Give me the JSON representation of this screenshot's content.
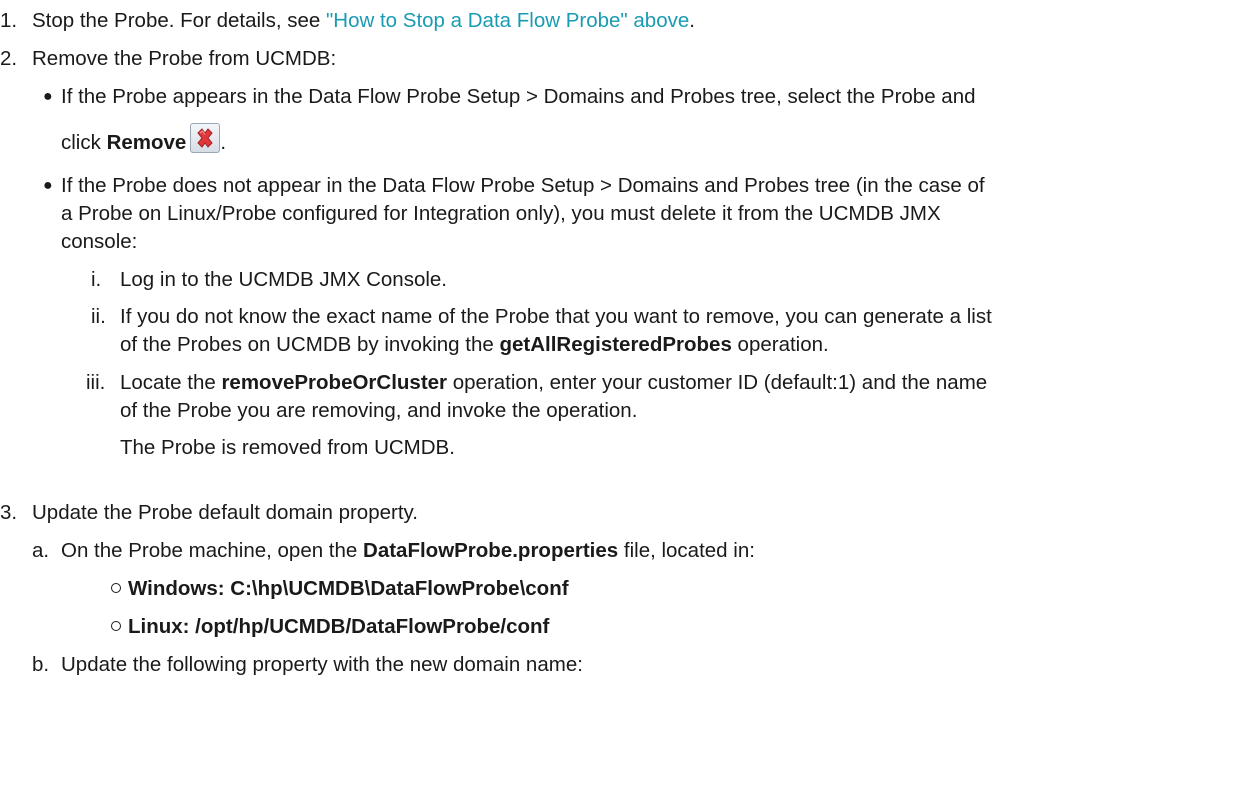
{
  "steps": {
    "s1": {
      "num": "1.",
      "pre": "Stop the Probe. For details, see ",
      "link": "\"How to Stop a Data Flow Probe\" above",
      "post": "."
    },
    "s2": {
      "num": "2.",
      "text": "Remove the Probe from UCMDB:",
      "bullet1": {
        "line1": "If the Probe appears in the Data Flow Probe Setup > Domains and Probes tree, select the Probe and",
        "line2_pre": "click ",
        "line2_bold": "Remove",
        "line2_post": ".",
        "icon": "remove-red-x-icon"
      },
      "bullet2": {
        "line1": "If the Probe does not appear in the Data Flow Probe Setup > Domains and Probes tree (in the case of",
        "line2": "a Probe on Linux/Probe configured for Integration only), you must delete it from the UCMDB JMX",
        "line3": "console:",
        "sub_i": {
          "num": "i.",
          "text": "Log in to the UCMDB JMX Console."
        },
        "sub_ii": {
          "num": "ii.",
          "line1": "If you do not know the exact name of the Probe that you want to remove, you can generate a list",
          "line2_pre": "of the Probes on UCMDB by invoking the ",
          "line2_bold": "getAllRegisteredProbes",
          "line2_post": " operation."
        },
        "sub_iii": {
          "num": "iii.",
          "line1_pre": "Locate the ",
          "line1_bold": "removeProbeOrCluster",
          "line1_post": " operation, enter your customer ID (default:1) and the name",
          "line2": "of the Probe you are removing, and invoke the operation.",
          "line3": "The Probe is removed from UCMDB."
        }
      }
    },
    "s3": {
      "num": "3.",
      "text": "Update the Probe default domain property.",
      "sub_a": {
        "num": "a.",
        "pre": "On the Probe machine, open the ",
        "bold": "DataFlowProbe.properties",
        "post": " file, located in:",
        "paths": [
          "Windows: C:\\hp\\UCMDB\\DataFlowProbe\\conf",
          "Linux: /opt/hp/UCMDB/DataFlowProbe/conf"
        ]
      },
      "sub_b": {
        "num": "b.",
        "text": "Update the following property with the new domain name:"
      }
    }
  }
}
